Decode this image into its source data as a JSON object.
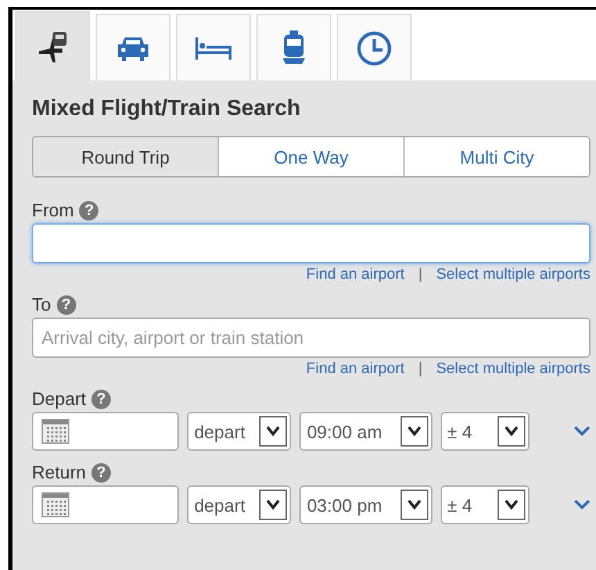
{
  "tabs": [
    {
      "kind": "flight-train",
      "selected": true
    },
    {
      "kind": "car",
      "selected": false
    },
    {
      "kind": "hotel",
      "selected": false
    },
    {
      "kind": "train",
      "selected": false
    },
    {
      "kind": "clock",
      "selected": false
    }
  ],
  "title": "Mixed Flight/Train Search",
  "trip_types": [
    {
      "label": "Round Trip",
      "selected": true
    },
    {
      "label": "One Way",
      "selected": false
    },
    {
      "label": "Multi City",
      "selected": false
    }
  ],
  "locations": [
    {
      "label": "From",
      "help": "?",
      "focused": true,
      "links": [
        "Find an airport",
        "Select multiple airports"
      ],
      "separator": "|"
    },
    {
      "label": "To",
      "help": "?",
      "placeholder": "Arrival city, airport or train station",
      "focused": false,
      "links": [
        "Find an airport",
        "Select multiple airports"
      ],
      "separator": "|"
    }
  ],
  "dates": [
    {
      "label": "Depart",
      "help": "?",
      "mode": "depart",
      "time": "09:00 am",
      "window": "± 4"
    },
    {
      "label": "Return",
      "help": "?",
      "mode": "depart",
      "time": "03:00 pm",
      "window": "± 4"
    }
  ]
}
